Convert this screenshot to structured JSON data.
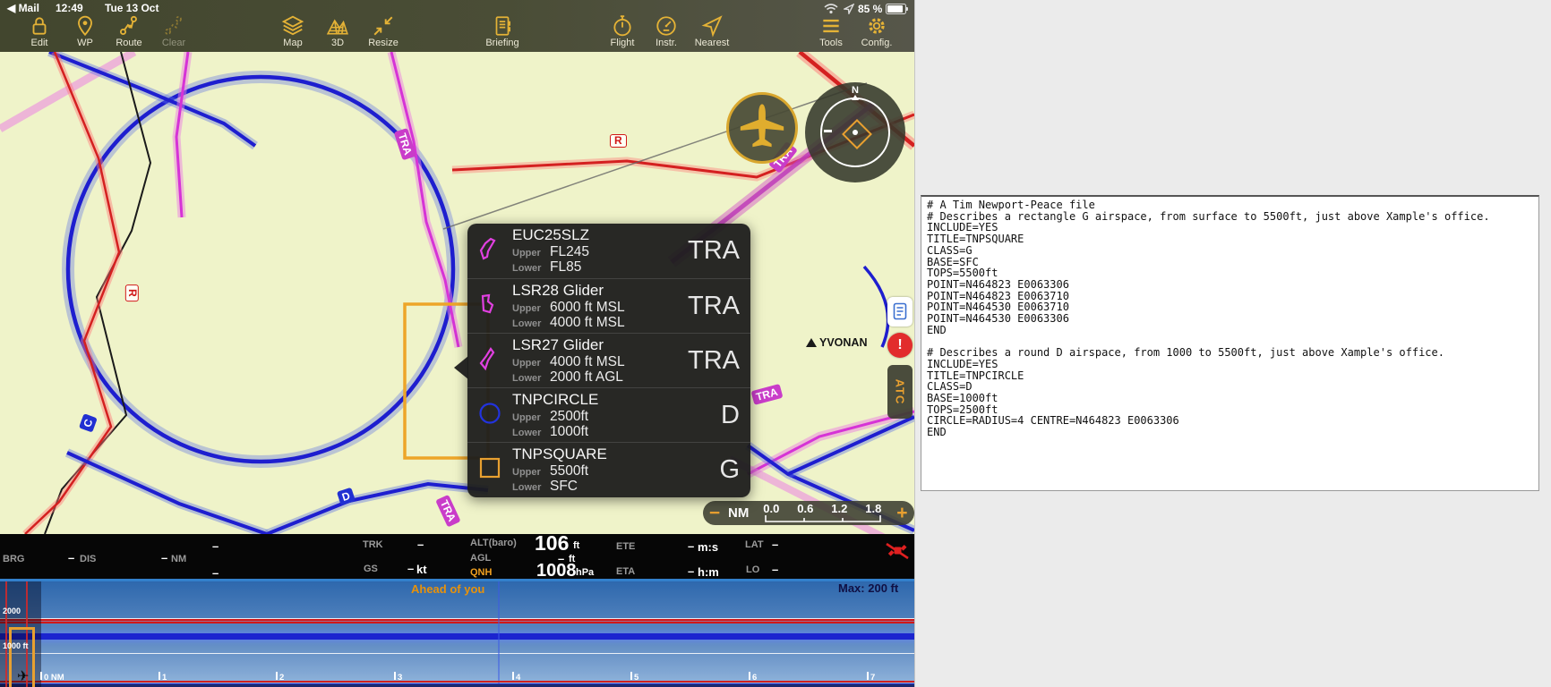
{
  "colors": {
    "toolbar_icon": "#e4b236",
    "map_background": "#eff3c9",
    "airspace_blue": "#1e1ecf",
    "airspace_magenta": "#d633d6",
    "airspace_red": "#d42020",
    "airspace_orange": "#eda529",
    "qnh_label": "#f0a020",
    "profile_warning": "#e8920a"
  },
  "status_bar": {
    "back_label": "◀ Mail",
    "time": "12:49",
    "date": "Tue 13 Oct",
    "battery_pct": "85 %"
  },
  "toolbar": {
    "items": [
      {
        "label": "Edit"
      },
      {
        "label": "WP"
      },
      {
        "label": "Route"
      },
      {
        "label": "Clear"
      },
      {
        "label": "Map"
      },
      {
        "label": "3D"
      },
      {
        "label": "Resize"
      },
      {
        "label": "Briefing"
      },
      {
        "label": "Flight"
      },
      {
        "label": "Instr."
      },
      {
        "label": "Nearest"
      },
      {
        "label": "Tools"
      },
      {
        "label": "Config."
      }
    ]
  },
  "map": {
    "airspace_labels": {
      "tra": "TRA",
      "r": "R",
      "d": "D",
      "c": "C"
    },
    "waypoint": "YVONAN",
    "compass_north": "N",
    "side_buttons": {
      "alert": "!",
      "atc": "ATC"
    },
    "scale_bar": {
      "zoom_out": "−",
      "unit": "NM",
      "ticks": [
        "0.0",
        "0.6",
        "1.2",
        "1.8"
      ],
      "zoom_in": "+"
    }
  },
  "airspace_popup": {
    "upper_label": "Upper",
    "lower_label": "Lower",
    "rows": [
      {
        "name": "EUC25SLZ",
        "upper": "FL245",
        "lower": "FL85",
        "class": "TRA"
      },
      {
        "name": "LSR28 Glider",
        "upper": "6000 ft MSL",
        "lower": "4000 ft MSL",
        "class": "TRA"
      },
      {
        "name": "LSR27 Glider",
        "upper": "4000 ft MSL",
        "lower": "2000 ft AGL",
        "class": "TRA"
      },
      {
        "name": "TNPCIRCLE",
        "upper": "2500ft",
        "lower": "1000ft",
        "class": "D"
      },
      {
        "name": "TNPSQUARE",
        "upper": "5500ft",
        "lower": "SFC",
        "class": "G"
      }
    ]
  },
  "instrument_bar": {
    "brg_label": "BRG",
    "dis_label": "DIS",
    "nm_unit": "NM",
    "trk_label": "TRK",
    "gs_label": "GS",
    "kt_unit": "kt",
    "alt_label": "ALT(baro)",
    "alt_value": "106",
    "alt_unit": "ft",
    "agl_label": "AGL",
    "agl_unit": "ft",
    "qnh_label": "QNH",
    "qnh_value": "1008",
    "qnh_unit": "hPa",
    "ete_label": "ETE",
    "eta_label": "ETA",
    "ms_unit": "m:s",
    "hm_unit": "h:m",
    "lat_label": "LAT",
    "lon_label": "LO",
    "no_value": "–"
  },
  "elevation_profile": {
    "ahead_text": "Ahead of you",
    "max_text": "Max: 200 ft",
    "alt_2000": "2000",
    "alt_1000": "1000 ft",
    "distance_ticks": [
      "0 NM",
      "1",
      "2",
      "3",
      "4",
      "5",
      "6",
      "7"
    ]
  },
  "airspace_file_editor": {
    "text": "# A Tim Newport-Peace file\n# Describes a rectangle G airspace, from surface to 5500ft, just above Xample's office.\nINCLUDE=YES\nTITLE=TNPSQUARE\nCLASS=G\nBASE=SFC\nTOPS=5500ft\nPOINT=N464823 E0063306\nPOINT=N464823 E0063710\nPOINT=N464530 E0063710\nPOINT=N464530 E0063306\nEND\n\n# Describes a round D airspace, from 1000 to 5500ft, just above Xample's office.\nINCLUDE=YES\nTITLE=TNPCIRCLE\nCLASS=D\nBASE=1000ft\nTOPS=2500ft\nCIRCLE=RADIUS=4 CENTRE=N464823 E0063306\nEND"
  }
}
